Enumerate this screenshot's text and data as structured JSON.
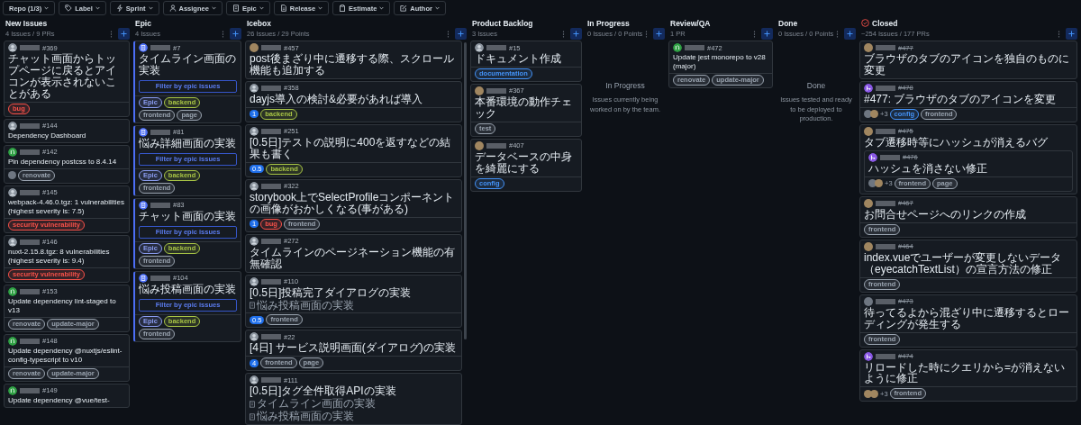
{
  "filters": [
    {
      "label": "Repo (1/3)"
    },
    {
      "label": "Label"
    },
    {
      "label": "Sprint"
    },
    {
      "label": "Assignee"
    },
    {
      "label": "Epic"
    },
    {
      "label": "Release"
    },
    {
      "label": "Estimate"
    },
    {
      "label": "Author"
    }
  ],
  "columns": [
    {
      "title": "New Issues",
      "count": "4 Issues / 9 PRs",
      "closed": false,
      "scrollbar": false,
      "cards": [
        {
          "kind": "user",
          "number": "#369",
          "title": "チャット画面からトップページに戻るとアイコンが表示されないことがある",
          "labels": [
            {
              "text": "bug",
              "color": "#f85149"
            }
          ]
        },
        {
          "kind": "user",
          "number": "#144",
          "title": "Dependency Dashboard"
        },
        {
          "kind": "pr-open",
          "number": "#142",
          "title": "Pin dependency postcss to 8.4.14",
          "assignees": [
            {
              "kind": "plain"
            }
          ],
          "labels": [
            {
              "text": "renovate",
              "color": "#9aa4b0"
            }
          ]
        },
        {
          "kind": "user",
          "number": "#145",
          "title": "webpack-4.46.0.tgz: 1 vulnerabilities (highest severity is: 7.5)",
          "labels": [
            {
              "text": "security vulnerability",
              "color": "#f85149"
            }
          ]
        },
        {
          "kind": "user",
          "number": "#146",
          "title": "nuxt-2.15.8.tgz: 8 vulnerabilities (highest severity is: 9.4)",
          "labels": [
            {
              "text": "security vulnerability",
              "color": "#f85149"
            }
          ]
        },
        {
          "kind": "pr-open",
          "number": "#153",
          "title": "Update dependency lint-staged to v13",
          "labels": [
            {
              "text": "renovate",
              "color": "#9aa4b0"
            },
            {
              "text": "update-major",
              "color": "#9aa4b0"
            }
          ]
        },
        {
          "kind": "pr-open",
          "number": "#148",
          "title": "Update dependency @nuxtjs/eslint-config-typescript to v10",
          "labels": [
            {
              "text": "renovate",
              "color": "#9aa4b0"
            },
            {
              "text": "update-major",
              "color": "#9aa4b0"
            }
          ]
        },
        {
          "kind": "pr-open",
          "number": "#149",
          "title": "Update dependency @vue/test-"
        }
      ]
    },
    {
      "title": "Epic",
      "count": "4 Issues",
      "closed": false,
      "scrollbar": false,
      "cards": [
        {
          "kind": "epic",
          "number": "#7",
          "title": "タイムライン画面の実装",
          "action": "Filter by epic issues",
          "labels": [
            {
              "text": "Epic",
              "color": "#8a9cf0"
            },
            {
              "text": "backend",
              "color": "#a8c545"
            },
            {
              "text": "frontend",
              "color": "#9aa4b0"
            },
            {
              "text": "page",
              "color": "#9aa4b0"
            }
          ]
        },
        {
          "kind": "epic",
          "number": "#81",
          "title": "悩み詳細画面の実装",
          "action": "Filter by epic issues",
          "labels": [
            {
              "text": "Epic",
              "color": "#8a9cf0"
            },
            {
              "text": "backend",
              "color": "#a8c545"
            },
            {
              "text": "frontend",
              "color": "#9aa4b0"
            }
          ]
        },
        {
          "kind": "epic",
          "number": "#83",
          "title": "チャット画面の実装",
          "action": "Filter by epic issues",
          "labels": [
            {
              "text": "Epic",
              "color": "#8a9cf0"
            },
            {
              "text": "backend",
              "color": "#a8c545"
            },
            {
              "text": "frontend",
              "color": "#9aa4b0"
            }
          ]
        },
        {
          "kind": "epic",
          "number": "#104",
          "title": "悩み投稿画面の実装",
          "action": "Filter by epic issues",
          "labels": [
            {
              "text": "Epic",
              "color": "#8a9cf0"
            },
            {
              "text": "backend",
              "color": "#a8c545"
            },
            {
              "text": "frontend",
              "color": "#9aa4b0"
            }
          ]
        }
      ]
    },
    {
      "title": "Icebox",
      "count": "26 Issues / 29 Points",
      "closed": false,
      "scrollbar": true,
      "cards": [
        {
          "kind": "photo",
          "number": "#457",
          "title": "post後まざり中に遷移する際、スクロール機能も追加する"
        },
        {
          "kind": "user",
          "number": "#358",
          "title": "dayjs導入の検討&必要があれば導入",
          "estimate": "1",
          "labels": [
            {
              "text": "backend",
              "color": "#a8c545"
            }
          ]
        },
        {
          "kind": "user",
          "number": "#251",
          "title": "[0.5日]テストの説明に400を返すなどの結果も書く",
          "estimate": "0.5",
          "labels": [
            {
              "text": "backend",
              "color": "#a8c545"
            }
          ]
        },
        {
          "kind": "user",
          "number": "#322",
          "title": "storybook上でSelectProfileコンポーネントの画像がおかしくなる(事がある)",
          "estimate": "1",
          "labels": [
            {
              "text": "bug",
              "color": "#f85149"
            },
            {
              "text": "frontend",
              "color": "#9aa4b0"
            }
          ]
        },
        {
          "kind": "user",
          "number": "#272",
          "title": "タイムラインのページネーション機能の有無確認"
        },
        {
          "kind": "user",
          "number": "#110",
          "title": "[0.5日]投稿完了ダイアログの実装",
          "epics": [
            "悩み投稿画面の実装"
          ],
          "estimate": "0.5",
          "labels": [
            {
              "text": "frontend",
              "color": "#9aa4b0"
            }
          ]
        },
        {
          "kind": "user",
          "number": "#22",
          "title": "[4日] サービス説明画面(ダイアログ)の実装",
          "estimate": "4",
          "labels": [
            {
              "text": "frontend",
              "color": "#9aa4b0"
            },
            {
              "text": "page",
              "color": "#9aa4b0"
            }
          ]
        },
        {
          "kind": "user",
          "number": "#111",
          "title": "[0.5日]タグ全件取得APIの実装",
          "epics": [
            "タイムライン画面の実装",
            "悩み投稿画面の実装"
          ]
        }
      ]
    },
    {
      "title": "Product Backlog",
      "count": "3 Issues",
      "closed": false,
      "scrollbar": false,
      "cards": [
        {
          "kind": "user",
          "number": "#15",
          "title": "ドキュメント作成",
          "labels": [
            {
              "text": "documentation",
              "color": "#4493f8"
            }
          ]
        },
        {
          "kind": "photo",
          "number": "#367",
          "title": "本番環境の動作チェック",
          "labels": [
            {
              "text": "test",
              "color": "#9aa4b0"
            }
          ]
        },
        {
          "kind": "photo",
          "number": "#407",
          "title": "データベースの中身を綺麗にする",
          "labels": [
            {
              "text": "config",
              "color": "#4493f8"
            }
          ]
        }
      ]
    },
    {
      "title": "In Progress",
      "count": "0 Issues / 0 Points",
      "closed": false,
      "scrollbar": false,
      "empty": {
        "title": "In Progress",
        "text": "Issues currently being worked on by the team."
      }
    },
    {
      "title": "Review/QA",
      "count": "1 PR",
      "closed": false,
      "scrollbar": false,
      "cards": [
        {
          "kind": "pr-open",
          "number": "#472",
          "title": "Update jest monorepo to v28 (major)",
          "labels": [
            {
              "text": "renovate",
              "color": "#9aa4b0"
            },
            {
              "text": "update-major",
              "color": "#9aa4b0"
            }
          ]
        }
      ]
    },
    {
      "title": "Done",
      "count": "0 Issues / 0 Points",
      "closed": false,
      "scrollbar": false,
      "empty": {
        "title": "Done",
        "text": "Issues tested and ready to be deployed to production."
      }
    },
    {
      "title": "Closed",
      "count": "~254 Issues / 177 PRs",
      "closed": true,
      "scrollbar": false,
      "cards": [
        {
          "kind": "photo",
          "number": "#477",
          "title": "ブラウザのタブのアイコンを独自のものに変更"
        },
        {
          "kind": "pr-merged",
          "number": "#478",
          "title": "#477: ブラウザのタブのアイコンを変更",
          "assignees": [
            {
              "kind": "plain"
            },
            {
              "kind": "photo"
            }
          ],
          "more": "+3",
          "labels": [
            {
              "text": "config",
              "color": "#4493f8"
            },
            {
              "text": "frontend",
              "color": "#9aa4b0"
            }
          ]
        },
        {
          "kind": "photo",
          "number": "#475",
          "title": "タブ遷移時等にハッシュが消えるバグ",
          "children": [
            {
              "kind": "pr-merged",
              "number": "#476",
              "title": "ハッシュを消さない修正",
              "assignees": [
                {
                  "kind": "plain"
                },
                {
                  "kind": "photo"
                }
              ],
              "more": "+3",
              "labels": [
                {
                  "text": "frontend",
                  "color": "#9aa4b0"
                },
                {
                  "text": "page",
                  "color": "#9aa4b0"
                }
              ]
            }
          ]
        },
        {
          "kind": "photo",
          "number": "#467",
          "title": "お問合せページへのリンクの作成",
          "labels": [
            {
              "text": "frontend",
              "color": "#9aa4b0"
            }
          ]
        },
        {
          "kind": "photo",
          "number": "#464",
          "title": "index.vueでユーザーが変更しないデータ（eyecatchTextList）の宣言方法の修正",
          "labels": [
            {
              "text": "frontend",
              "color": "#9aa4b0"
            }
          ]
        },
        {
          "kind": "plain",
          "number": "#473",
          "title": "待ってるよから混ざり中に遷移するとローディングが発生する",
          "labels": [
            {
              "text": "frontend",
              "color": "#9aa4b0"
            }
          ]
        },
        {
          "kind": "pr-merged",
          "number": "#474",
          "title": "リロードした時にクエリから=が消えないように修正",
          "assignees": [
            {
              "kind": "photo"
            },
            {
              "kind": "photo"
            }
          ],
          "more": "+3",
          "labels": [
            {
              "text": "frontend",
              "color": "#9aa4b0"
            }
          ]
        }
      ]
    }
  ]
}
